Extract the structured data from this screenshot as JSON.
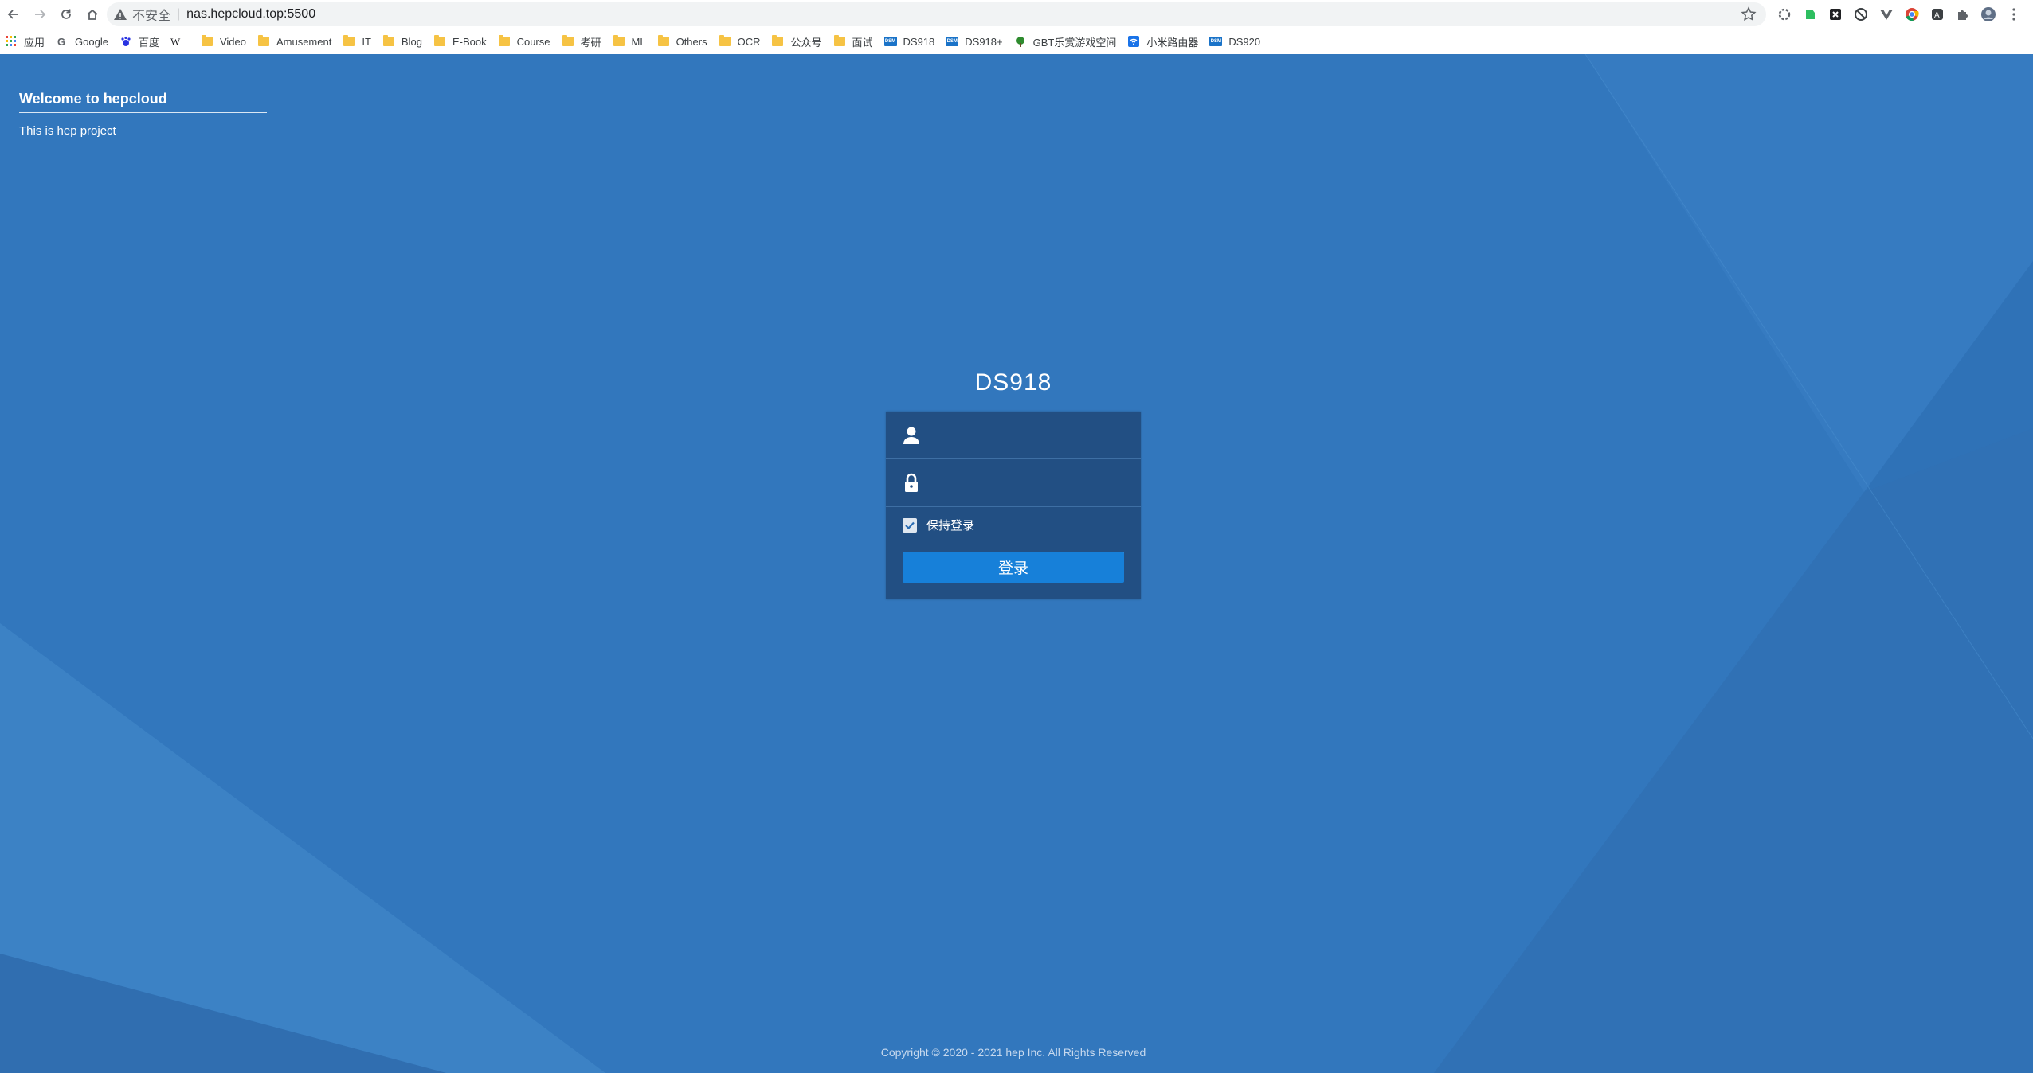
{
  "browser": {
    "not_secure": "不安全",
    "url": "nas.hepcloud.top:5500",
    "nav_icons": [
      "back-arrow-icon",
      "forward-arrow-icon",
      "reload-icon",
      "home-icon"
    ],
    "extension_icons": [
      "gear-extension-icon",
      "evernote-icon",
      "close-box-icon",
      "no-sign-icon",
      "vue-icon",
      "chrome-icon",
      "translate-icon",
      "puzzle-icon",
      "avatar-icon",
      "menu-icon"
    ]
  },
  "bookmarks": [
    {
      "label": "应用",
      "icon": "apps-grid-icon"
    },
    {
      "label": "Google",
      "icon": "google-icon"
    },
    {
      "label": "百度",
      "icon": "baidu-icon"
    },
    {
      "label": "",
      "icon": "wikipedia-icon"
    },
    {
      "label": "Video",
      "icon": "folder-icon"
    },
    {
      "label": "Amusement",
      "icon": "folder-icon"
    },
    {
      "label": "IT",
      "icon": "folder-icon"
    },
    {
      "label": "Blog",
      "icon": "folder-icon"
    },
    {
      "label": "E-Book",
      "icon": "folder-icon"
    },
    {
      "label": "Course",
      "icon": "folder-icon"
    },
    {
      "label": "考研",
      "icon": "folder-icon"
    },
    {
      "label": "ML",
      "icon": "folder-icon"
    },
    {
      "label": "Others",
      "icon": "folder-icon"
    },
    {
      "label": "OCR",
      "icon": "folder-icon"
    },
    {
      "label": "公众号",
      "icon": "folder-icon"
    },
    {
      "label": "面试",
      "icon": "folder-icon"
    },
    {
      "label": "DS918",
      "icon": "dsm-icon"
    },
    {
      "label": "DS918+",
      "icon": "dsm-icon"
    },
    {
      "label": "GBT乐赏游戏空间",
      "icon": "tree-icon"
    },
    {
      "label": "小米路由器",
      "icon": "wifi-icon"
    },
    {
      "label": "DS920",
      "icon": "dsm-icon"
    }
  ],
  "page": {
    "welcome_title": "Welcome to hepcloud",
    "welcome_text": "This is hep project",
    "login_title": "DS918",
    "username_placeholder": "",
    "password_placeholder": "",
    "remember_label": "保持登录",
    "remember_checked": true,
    "login_button": "登录",
    "copyright": "Copyright © 2020 - 2021 hep Inc. All Rights Reserved"
  },
  "colors": {
    "background": "#3277bd",
    "login_panel": "#224f83",
    "login_button": "#1780d9"
  }
}
